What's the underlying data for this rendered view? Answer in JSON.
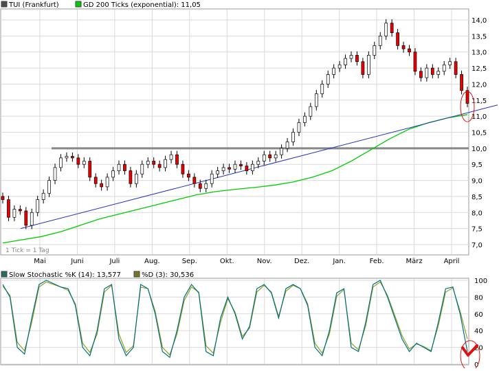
{
  "colors": {
    "grid": "#d9d9d9",
    "candle": "#000000",
    "up": "#ffffff",
    "down": "#ee0000",
    "sma": "#00cc00",
    "trend": "#2233bb",
    "resist": "#888888",
    "annot": "#dd1111",
    "stochK": "#007080",
    "stochD": "#90a020"
  },
  "main_legend": {
    "price_label": "TUI (Frankfurt)",
    "sma_label": "GD 200 Ticks (exponential): 11,05",
    "price_swatch": "#4a4a4a",
    "sma_swatch": "#00cc00"
  },
  "tick_note": "1 Tick = 1 Tag",
  "stoch_legend": {
    "k_label": "Slow Stochastic %K (14): 13,577",
    "d_label": "%D (3): 30,536",
    "k_swatch": "#2a6a66",
    "d_swatch": "#777722"
  },
  "chart_data": [
    {
      "type": "candlestick",
      "title": "TUI (Frankfurt)",
      "x_ticks": [
        "Mai",
        "Juni",
        "Juli",
        "Aug.",
        "Sep.",
        "Okt.",
        "Nov.",
        "Dez.",
        "Jan.",
        "Feb.",
        "März",
        "April"
      ],
      "y_ticks": [
        "14,0",
        "13,5",
        "13,0",
        "12,5",
        "12,0",
        "11,5",
        "11,0",
        "10,5",
        "10,0",
        "9,5",
        "9,0",
        "8,5",
        "8,0",
        "7,5",
        "7,0"
      ],
      "ylim": [
        6.7,
        14.3
      ],
      "close": [
        8.4,
        7.85,
        8.1,
        8.05,
        7.6,
        8.0,
        8.4,
        8.6,
        9.0,
        9.4,
        9.7,
        9.75,
        9.7,
        9.5,
        9.6,
        9.1,
        8.9,
        8.8,
        9.1,
        9.3,
        9.5,
        9.3,
        8.9,
        9.2,
        9.5,
        9.6,
        9.5,
        9.4,
        9.65,
        9.8,
        9.5,
        9.2,
        9.1,
        8.9,
        8.75,
        8.9,
        9.2,
        9.3,
        9.4,
        9.35,
        9.5,
        9.45,
        9.3,
        9.5,
        9.6,
        9.8,
        9.7,
        9.8,
        10.0,
        10.2,
        10.5,
        10.8,
        11.0,
        11.3,
        11.7,
        12.0,
        12.3,
        12.5,
        12.6,
        12.8,
        12.9,
        12.7,
        12.3,
        12.9,
        13.2,
        13.5,
        13.9,
        13.6,
        13.2,
        13.1,
        13.0,
        12.4,
        12.2,
        12.5,
        12.3,
        12.4,
        12.6,
        12.7,
        12.3,
        11.8,
        11.4
      ],
      "sma_200": [
        7.05,
        7.15,
        7.25,
        7.4,
        7.6,
        7.8,
        7.95,
        8.1,
        8.25,
        8.4,
        8.55,
        8.65,
        8.72,
        8.78,
        8.85,
        8.95,
        9.1,
        9.3,
        9.6,
        9.95,
        10.3,
        10.6,
        10.8,
        10.95,
        11.05
      ],
      "trend_line": {
        "from": 7.5,
        "to": 11.35
      },
      "resistance": 10.0
    },
    {
      "type": "line",
      "title": "Slow Stochastic",
      "y_ticks": [
        "100",
        "80",
        "60",
        "40",
        "20",
        "0"
      ],
      "ylim": [
        0,
        100
      ],
      "k_values": [
        95,
        80,
        20,
        12,
        55,
        95,
        100,
        96,
        92,
        90,
        70,
        20,
        10,
        40,
        90,
        95,
        30,
        10,
        20,
        95,
        90,
        60,
        15,
        8,
        40,
        80,
        95,
        85,
        15,
        10,
        55,
        80,
        60,
        30,
        45,
        90,
        95,
        85,
        55,
        90,
        95,
        90,
        70,
        20,
        10,
        40,
        85,
        90,
        20,
        15,
        50,
        95,
        100,
        80,
        55,
        30,
        15,
        25,
        20,
        15,
        50,
        90,
        92,
        60,
        15
      ],
      "d_values": [
        93,
        82,
        26,
        16,
        50,
        92,
        98,
        95,
        92,
        88,
        72,
        25,
        14,
        36,
        86,
        94,
        36,
        14,
        22,
        92,
        90,
        63,
        20,
        11,
        36,
        76,
        92,
        86,
        22,
        13,
        50,
        78,
        62,
        33,
        43,
        86,
        94,
        86,
        57,
        87,
        94,
        90,
        72,
        25,
        13,
        36,
        81,
        89,
        25,
        17,
        46,
        92,
        98,
        82,
        58,
        34,
        18,
        24,
        21,
        16,
        46,
        86,
        91,
        63,
        30
      ]
    }
  ]
}
